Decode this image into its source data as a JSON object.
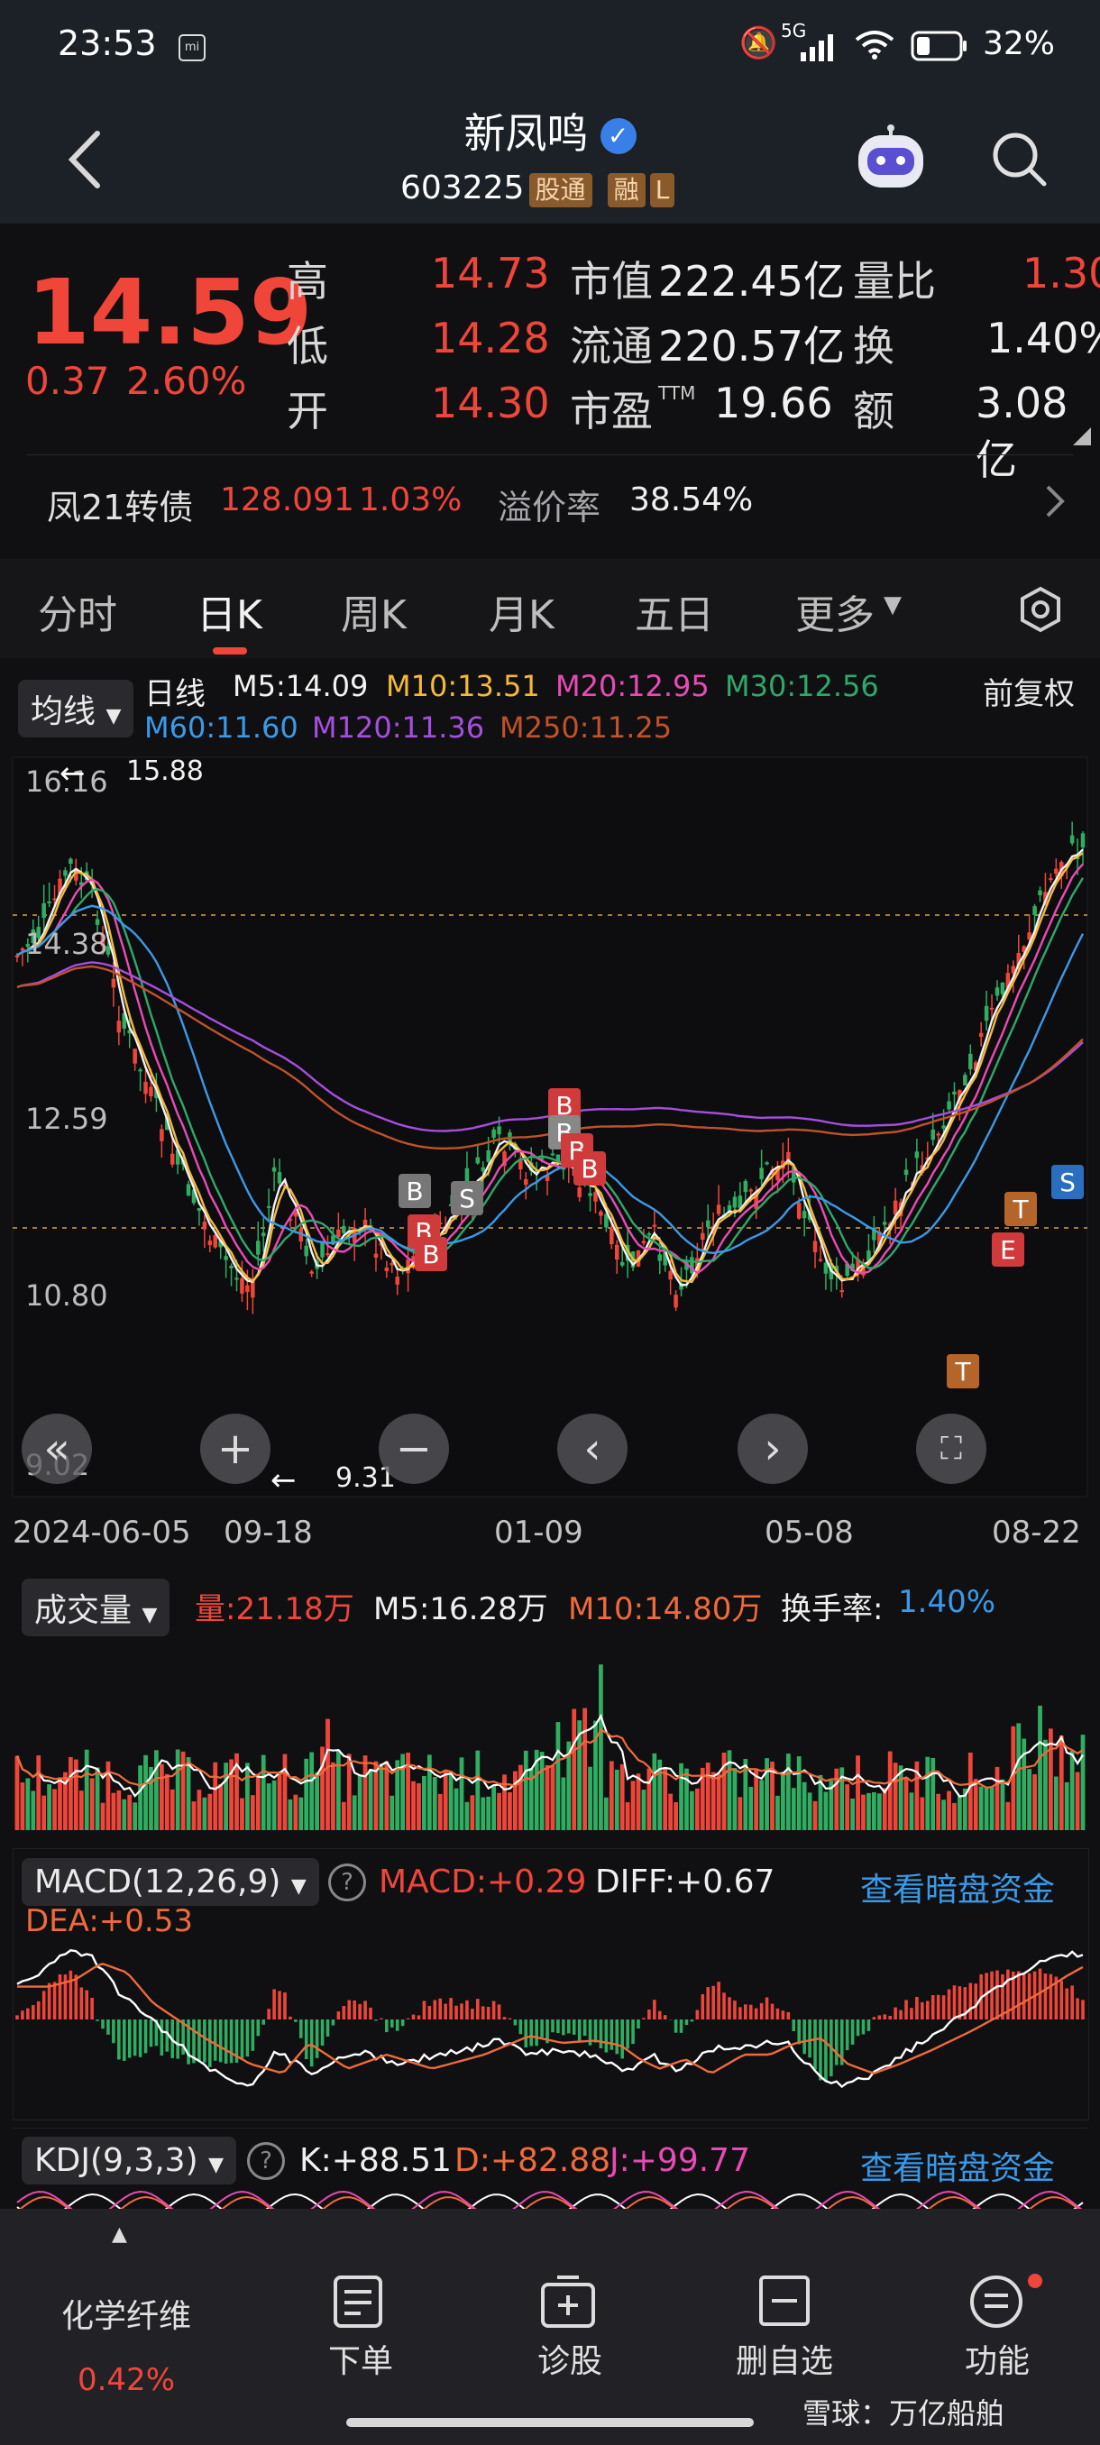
{
  "status_bar": {
    "time": "23:53",
    "battery": "32%",
    "network": "5G"
  },
  "header": {
    "stock_name": "新凤鸣",
    "code": "603225",
    "tags": [
      "股通",
      "融",
      "L"
    ]
  },
  "quote": {
    "price": "14.59",
    "change": "0.37",
    "change_pct": "2.60%",
    "rows": [
      {
        "l1": "高",
        "v1": "14.73",
        "l2": "市值",
        "v2": "222.45亿",
        "l3": "量比",
        "v3": "1.30"
      },
      {
        "l1": "低",
        "v1": "14.28",
        "l2": "流通",
        "v2": "220.57亿",
        "l3": "换",
        "v3": "1.40%"
      },
      {
        "l1": "开",
        "v1": "14.30",
        "l2": "市盈",
        "l2sup": "TTM",
        "v2": "19.66",
        "l3": "额",
        "v3": "3.08亿"
      }
    ],
    "bond": {
      "name": "凤21转债",
      "price": "128.091",
      "pct": "1.03%",
      "premium_label": "溢价率",
      "premium": "38.54%"
    }
  },
  "tabs": [
    {
      "label": "分时"
    },
    {
      "label": "日K"
    },
    {
      "label": "周K"
    },
    {
      "label": "月K"
    },
    {
      "label": "五日"
    },
    {
      "label": "更多"
    }
  ],
  "ma_bar": {
    "selector": "均线",
    "period": "日线",
    "adjust": "前复权",
    "items": [
      {
        "text": "M5:14.09",
        "color": "#f2f2f2"
      },
      {
        "text": "M10:13.51",
        "color": "#f5b93a"
      },
      {
        "text": "M20:12.95",
        "color": "#e84bb5"
      },
      {
        "text": "M30:12.56",
        "color": "#2fa86a"
      },
      {
        "text": "M60:11.60",
        "color": "#3a9ae8"
      },
      {
        "text": "M120:11.36",
        "color": "#a64ee0"
      },
      {
        "text": "M250:11.25",
        "color": "#c0522a"
      }
    ]
  },
  "price_axis": [
    "16.16",
    "14.38",
    "12.59",
    "10.80",
    "9.02"
  ],
  "extremes": {
    "high": "15.88",
    "low": "9.31"
  },
  "date_axis": [
    "2024-06-05",
    "09-18",
    "01-09",
    "05-08",
    "08-22"
  ],
  "volume": {
    "selector": "成交量",
    "vol": "量:21.18万",
    "m5": "M5:16.28万",
    "m10": "M10:14.80万",
    "turnover_label": "换手率:",
    "turnover": "1.40%"
  },
  "macd": {
    "selector": "MACD(12,26,9)",
    "macd": "MACD:+0.29",
    "diff": "DIFF:+0.67",
    "dea": "DEA:+0.53",
    "link": "查看暗盘资金"
  },
  "kdj": {
    "selector": "KDJ(9,3,3)",
    "k": "K:+88.51",
    "d": "D:+82.88",
    "j": "J:+99.77",
    "link": "查看暗盘资金"
  },
  "bottom_nav": [
    {
      "label": "化学纤维",
      "sub": "0.42%"
    },
    {
      "label": "下单"
    },
    {
      "label": "诊股"
    },
    {
      "label": "删自选"
    },
    {
      "label": "功能"
    }
  ],
  "watermark": "雪球：万亿船舶",
  "trade_markers": [
    "B",
    "S",
    "B",
    "B",
    "B",
    "B",
    "B",
    "S",
    "T",
    "T"
  ],
  "colors": {
    "up": "#f0463a",
    "down": "#2fae62",
    "link": "#3a9ae8"
  }
}
